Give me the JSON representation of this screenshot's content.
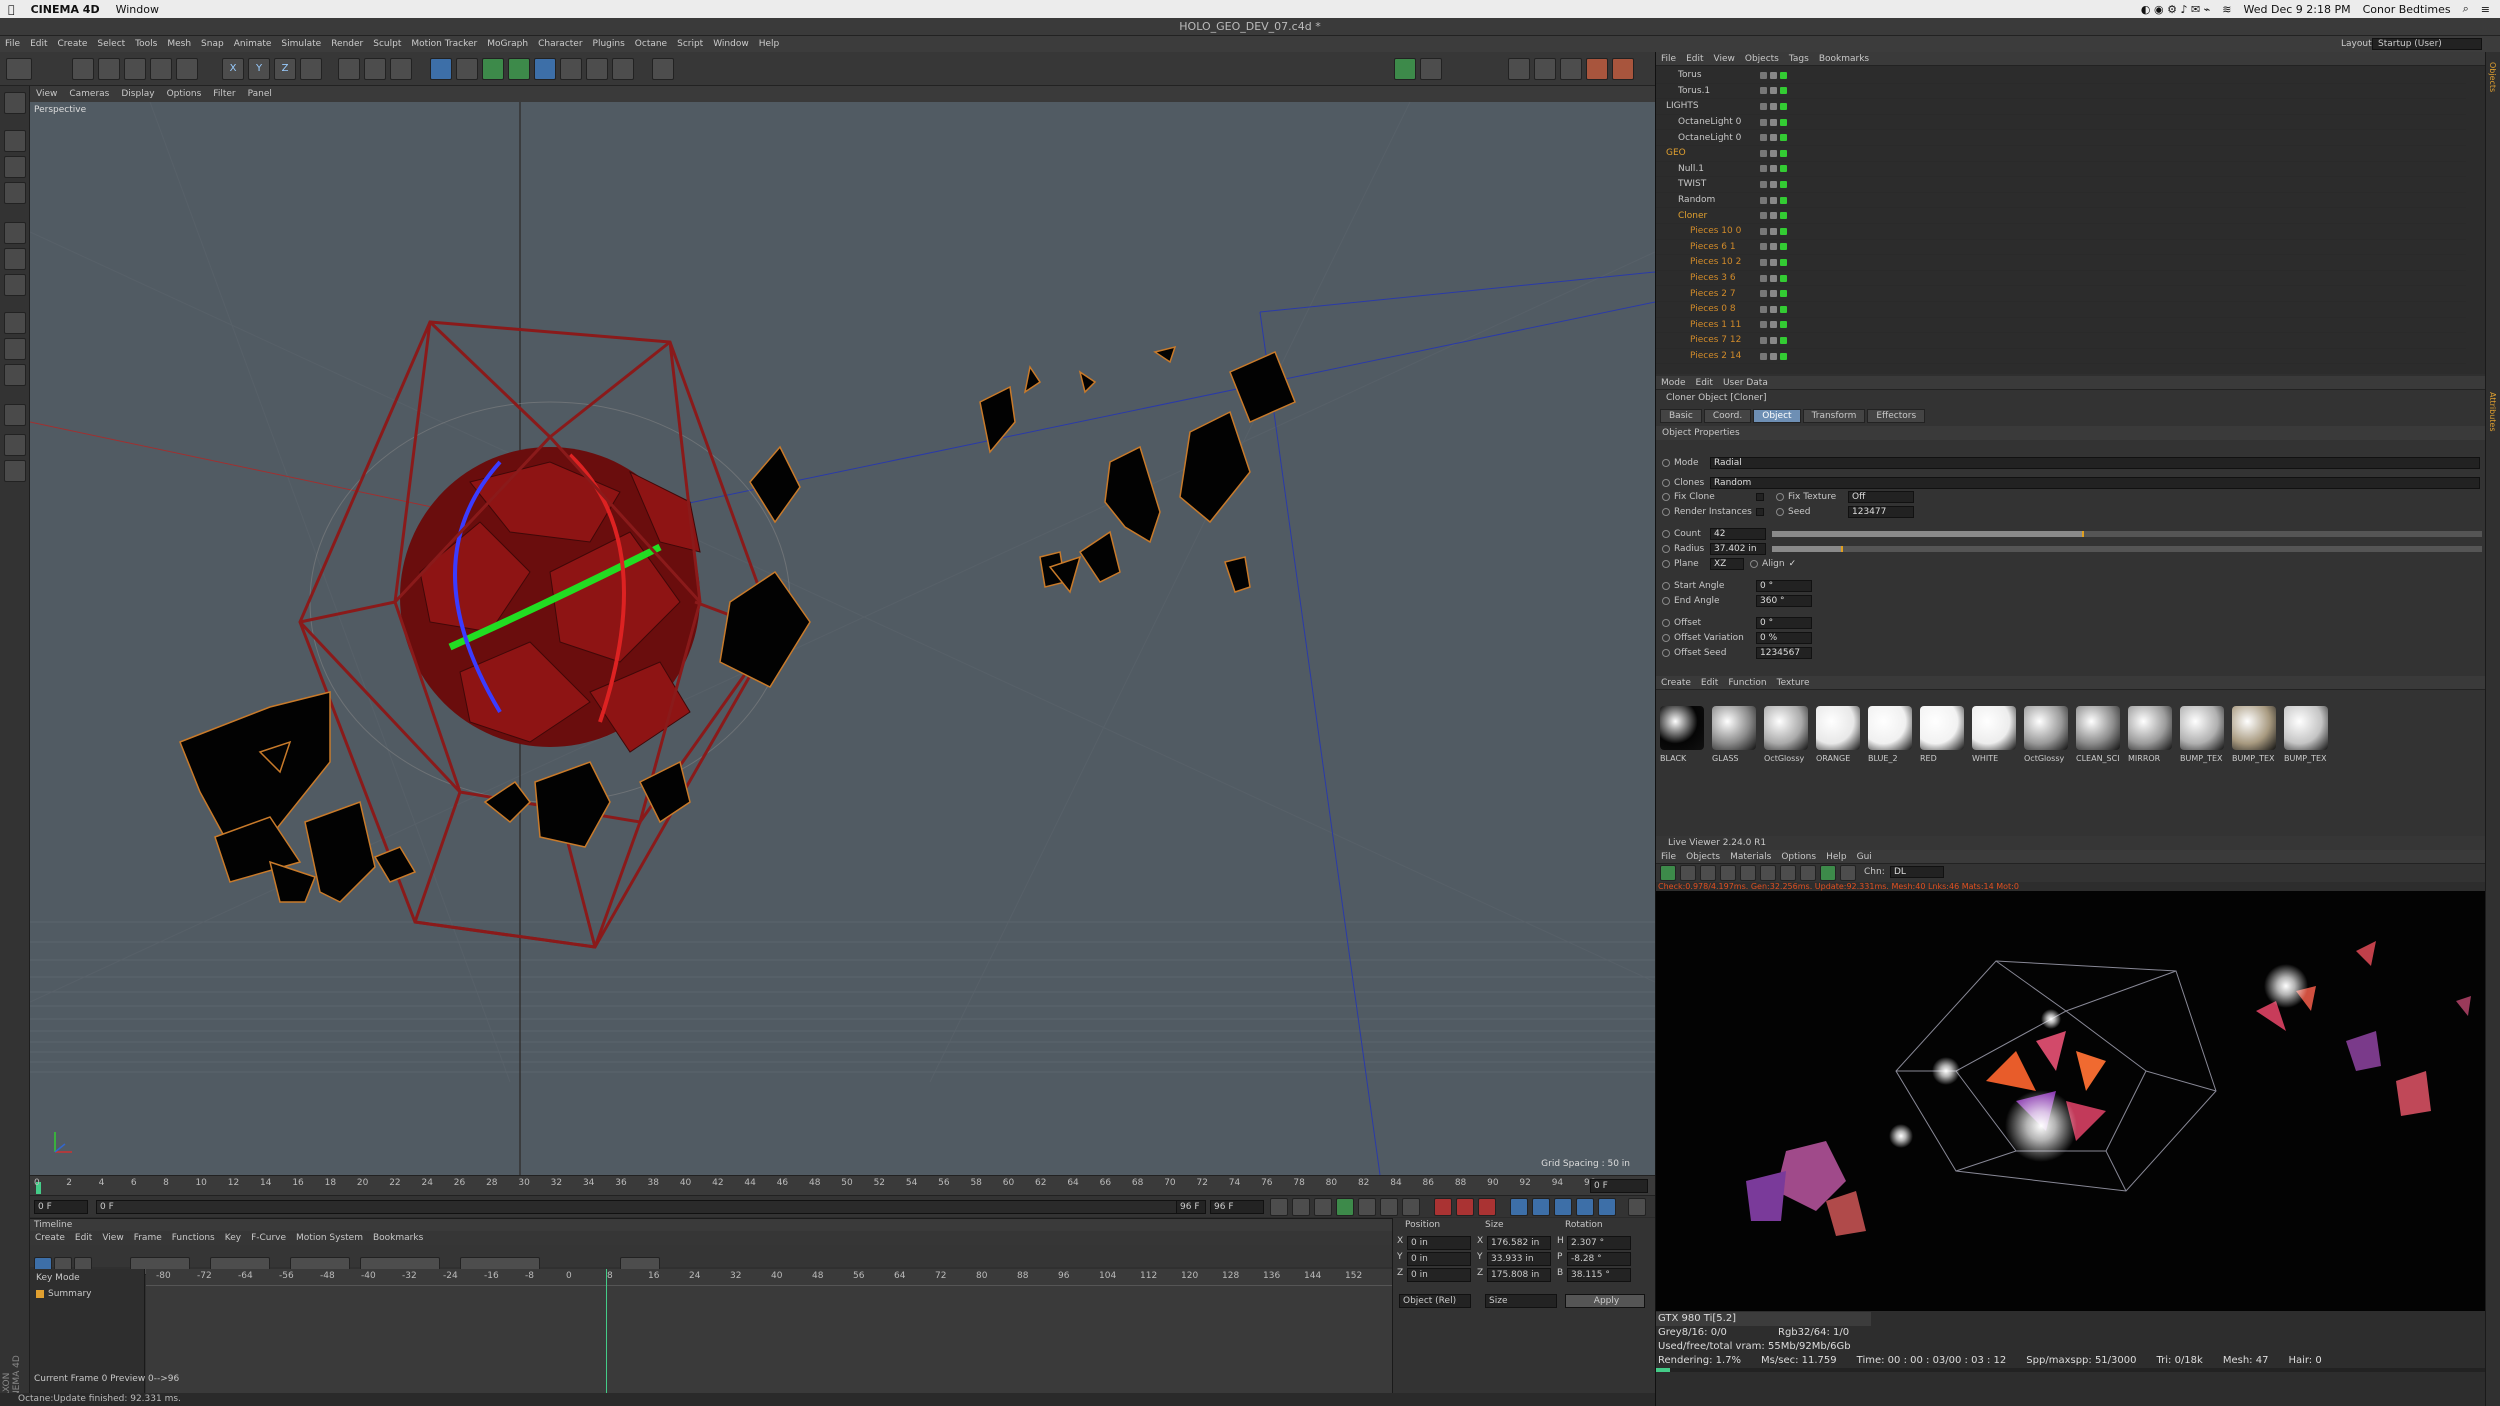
{
  "mac": {
    "app_name": "CINEMA 4D",
    "menu": [
      "Window"
    ],
    "clock": "Wed Dec 9  2:18 PM",
    "user": "Conor Bedtimes"
  },
  "window": {
    "title": "HOLO_GEO_DEV_07.c4d *"
  },
  "c4d_menu": [
    "File",
    "Edit",
    "Create",
    "Select",
    "Tools",
    "Mesh",
    "Snap",
    "Animate",
    "Simulate",
    "Render",
    "Sculpt",
    "Motion Tracker",
    "MoGraph",
    "Character",
    "Plugins",
    "Octane",
    "Script",
    "Window",
    "Help"
  ],
  "layout": {
    "label": "Layout:",
    "value": "Startup (User)"
  },
  "viewport": {
    "menu": [
      "View",
      "Cameras",
      "Display",
      "Options",
      "Filter",
      "Panel"
    ],
    "label": "Perspective",
    "grid_spacing": "Grid Spacing : 50 in"
  },
  "ruler": {
    "ticks": [
      "0",
      "2",
      "4",
      "6",
      "8",
      "10",
      "12",
      "14",
      "16",
      "18",
      "20",
      "22",
      "24",
      "26",
      "28",
      "30",
      "32",
      "34",
      "36",
      "38",
      "40",
      "42",
      "44",
      "46",
      "48",
      "50",
      "52",
      "54",
      "56",
      "58",
      "60",
      "62",
      "64",
      "66",
      "68",
      "70",
      "72",
      "74",
      "76",
      "78",
      "80",
      "82",
      "84",
      "86",
      "88",
      "90",
      "92",
      "94",
      "96"
    ],
    "end_field": "0 F"
  },
  "playback": {
    "current": "0 F",
    "start": "0 F",
    "end_a": "96 F",
    "end_b": "96 F"
  },
  "timeline": {
    "title": "Timeline",
    "menu": [
      "Create",
      "Edit",
      "View",
      "Frame",
      "Functions",
      "Key",
      "F-Curve",
      "Motion System",
      "Bookmarks"
    ],
    "key_mode": "Key Mode",
    "summary": "Summary",
    "ticks": [
      "-80",
      "-72",
      "-64",
      "-56",
      "-48",
      "-40",
      "-32",
      "-24",
      "-16",
      "-8",
      "0",
      "8",
      "16",
      "24",
      "32",
      "40",
      "48",
      "56",
      "64",
      "72",
      "80",
      "88",
      "96",
      "104",
      "112",
      "120",
      "128",
      "136",
      "144",
      "152"
    ],
    "current_frame": "Current Frame  0  Preview  0-->96"
  },
  "coords": {
    "headers": [
      "Position",
      "Size",
      "Rotation"
    ],
    "rows": [
      {
        "axis": "X",
        "pos": "0 in",
        "size_axis": "X",
        "size": "176.582 in",
        "rot_axis": "H",
        "rot": "2.307 °"
      },
      {
        "axis": "Y",
        "pos": "0 in",
        "size_axis": "Y",
        "size": "33.933 in",
        "rot_axis": "P",
        "rot": "-8.28 °"
      },
      {
        "axis": "Z",
        "pos": "0 in",
        "size_axis": "Z",
        "size": "175.808 in",
        "rot_axis": "B",
        "rot": "38.115 °"
      }
    ],
    "mode": "Object (Rel)",
    "size_mode": "Size",
    "apply": "Apply"
  },
  "status": "Octane:Update finished: 92.331 ms.",
  "object_manager": {
    "menu": [
      "File",
      "Edit",
      "View",
      "Objects",
      "Tags",
      "Bookmarks"
    ],
    "rows": [
      {
        "name": "Torus",
        "indent": 1,
        "color": "#c8c8c8"
      },
      {
        "name": "Torus.1",
        "indent": 1,
        "color": "#c8c8c8"
      },
      {
        "name": "LIGHTS",
        "indent": 0,
        "color": "#c8c8c8"
      },
      {
        "name": "OctaneLight 0",
        "indent": 1,
        "color": "#c8c8c8"
      },
      {
        "name": "OctaneLight 0",
        "indent": 1,
        "color": "#c8c8c8"
      },
      {
        "name": "GEO",
        "indent": 0,
        "color": "#e0a030"
      },
      {
        "name": "Null.1",
        "indent": 1,
        "color": "#c8c8c8"
      },
      {
        "name": "TWIST",
        "indent": 1,
        "color": "#c8c8c8"
      },
      {
        "name": "Random",
        "indent": 1,
        "color": "#c8c8c8"
      },
      {
        "name": "Cloner",
        "indent": 1,
        "color": "#e0a030"
      },
      {
        "name": "Pieces 10 0",
        "indent": 2,
        "color": "#d08a2a"
      },
      {
        "name": "Pieces 6 1",
        "indent": 2,
        "color": "#d08a2a"
      },
      {
        "name": "Pieces 10 2",
        "indent": 2,
        "color": "#d08a2a"
      },
      {
        "name": "Pieces 3 6",
        "indent": 2,
        "color": "#d08a2a"
      },
      {
        "name": "Pieces 2 7",
        "indent": 2,
        "color": "#d08a2a"
      },
      {
        "name": "Pieces 0 8",
        "indent": 2,
        "color": "#d08a2a"
      },
      {
        "name": "Pieces 1 11",
        "indent": 2,
        "color": "#d08a2a"
      },
      {
        "name": "Pieces 7 12",
        "indent": 2,
        "color": "#d08a2a"
      },
      {
        "name": "Pieces 2 14",
        "indent": 2,
        "color": "#d08a2a"
      }
    ]
  },
  "attributes": {
    "menu": [
      "Mode",
      "Edit",
      "User Data"
    ],
    "object_title": "Cloner Object [Cloner]",
    "tabs": [
      "Basic",
      "Coord.",
      "Object",
      "Transform",
      "Effectors"
    ],
    "active_tab": "Object",
    "section": "Object Properties",
    "mode_label": "Mode",
    "mode_value": "Radial",
    "clones_label": "Clones",
    "clones_value": "Random",
    "fix_clone": "Fix Clone",
    "fix_texture_label": "Fix Texture",
    "fix_texture_value": "Off",
    "render_instances": "Render Instances",
    "seed_label": "Seed",
    "seed_value": "123477",
    "count_label": "Count",
    "count_value": "42",
    "count_level": 0.44,
    "radius_label": "Radius",
    "radius_value": "37.402 in",
    "radius_level": 0.1,
    "plane_label": "Plane",
    "plane_value": "XZ",
    "align_label": "Align",
    "start_angle_label": "Start Angle",
    "start_angle_value": "0 °",
    "end_angle_label": "End Angle",
    "end_angle_value": "360 °",
    "offset_label": "Offset",
    "offset_value": "0 °",
    "offset_var_label": "Offset Variation",
    "offset_var_value": "0 %",
    "offset_seed_label": "Offset Seed",
    "offset_seed_value": "1234567"
  },
  "materials": {
    "menu": [
      "Create",
      "Edit",
      "Function",
      "Texture"
    ],
    "items": [
      {
        "name": "BLACK",
        "color": "#050505"
      },
      {
        "name": "GLASS",
        "color": "#8a8a8a"
      },
      {
        "name": "OctGlossy",
        "color": "#aaaaaa"
      },
      {
        "name": "ORANGE",
        "color": "#e8e8e8"
      },
      {
        "name": "BLUE_2",
        "color": "#f0f0f0"
      },
      {
        "name": "RED",
        "color": "#f2f2f2"
      },
      {
        "name": "WHITE",
        "color": "#ededed"
      },
      {
        "name": "OctGlossy",
        "color": "#9a9a9a"
      },
      {
        "name": "CLEAN_SCI",
        "color": "#8c8c8c"
      },
      {
        "name": "MIRROR",
        "color": "#9c9c9c"
      },
      {
        "name": "BUMP_TEX",
        "color": "#b0b0b0"
      },
      {
        "name": "BUMP_TEX",
        "color": "#a89a80"
      },
      {
        "name": "BUMP_TEX",
        "color": "#c4c4c4"
      }
    ]
  },
  "live_viewer": {
    "title": "Live Viewer 2.24.0 R1",
    "menu": [
      "File",
      "Objects",
      "Materials",
      "Options",
      "Help",
      "Gui"
    ],
    "channel_label": "Chn:",
    "channel_value": "DL",
    "check": "Check:0.978/4.197ms. Gen:32.256ms. Update:92.331ms. Mesh:40 Lnks:46 Mats:14 Mot:0",
    "gpu": "GTX 980 Ti[5.2]",
    "grey": "Grey8/16: 0/0",
    "rgb": "Rgb32/64: 1/0",
    "vram": "Used/free/total vram: 55Mb/92Mb/6Gb",
    "rendering": "Rendering:  1.7%",
    "mspersec": "Ms/sec: 11.759",
    "time": "Time: 00 : 00 : 03/00 : 03 : 12",
    "spp": "Spp/maxspp: 51/3000",
    "tri": "Tri: 0/18k",
    "mesh": "Mesh: 47",
    "hair": "Hair: 0",
    "progress": 0.017
  },
  "colors": {
    "accent": "#e0a030",
    "highlight_tab": "#6e8fb4",
    "red_wire": "#8a1a1a",
    "green_ring": "#22dd22",
    "blue_ring": "#3b3bff"
  }
}
